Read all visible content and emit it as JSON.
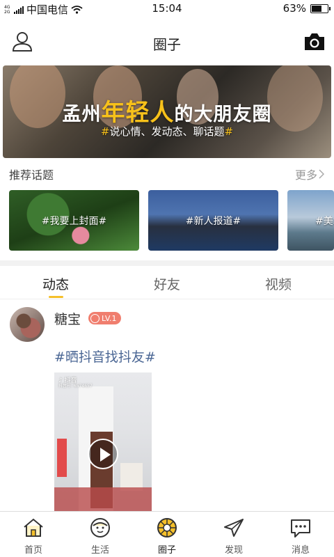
{
  "status_bar": {
    "network_type": "4G 2G",
    "carrier": "中国电信",
    "time": "15:04",
    "battery": "63%",
    "battery_level": 0.63
  },
  "header": {
    "title": "圈子",
    "left_icon": "user-icon",
    "right_icon": "camera-icon"
  },
  "banner": {
    "title_prefix": "孟州",
    "title_highlight": "年轻人",
    "title_suffix": "的大朋友圈",
    "subtitle_hash1": "#",
    "subtitle": "说心情、发动态、聊话题",
    "subtitle_hash2": "#"
  },
  "recommended": {
    "title": "推荐话题",
    "more": "更多",
    "topics": [
      {
        "label": "#我要上封面#"
      },
      {
        "label": "#新人报道#"
      },
      {
        "label": "#美术"
      }
    ]
  },
  "tabs": [
    {
      "label": "动态"
    },
    {
      "label": "好友"
    },
    {
      "label": "视频"
    }
  ],
  "post": {
    "username": "糖宝",
    "level": "LV.1",
    "text": "#晒抖音找抖友#",
    "video_logo": "抖音",
    "video_id": "抖音号: 6574657"
  },
  "bottom_nav": [
    {
      "label": "首页",
      "icon": "home-icon"
    },
    {
      "label": "生活",
      "icon": "life-icon"
    },
    {
      "label": "圈子",
      "icon": "circle-icon"
    },
    {
      "label": "发现",
      "icon": "discover-icon"
    },
    {
      "label": "消息",
      "icon": "message-icon"
    }
  ],
  "colors": {
    "accent": "#f5c02a",
    "topic_link": "#4a6694",
    "level_badge": "#f07e6e"
  }
}
